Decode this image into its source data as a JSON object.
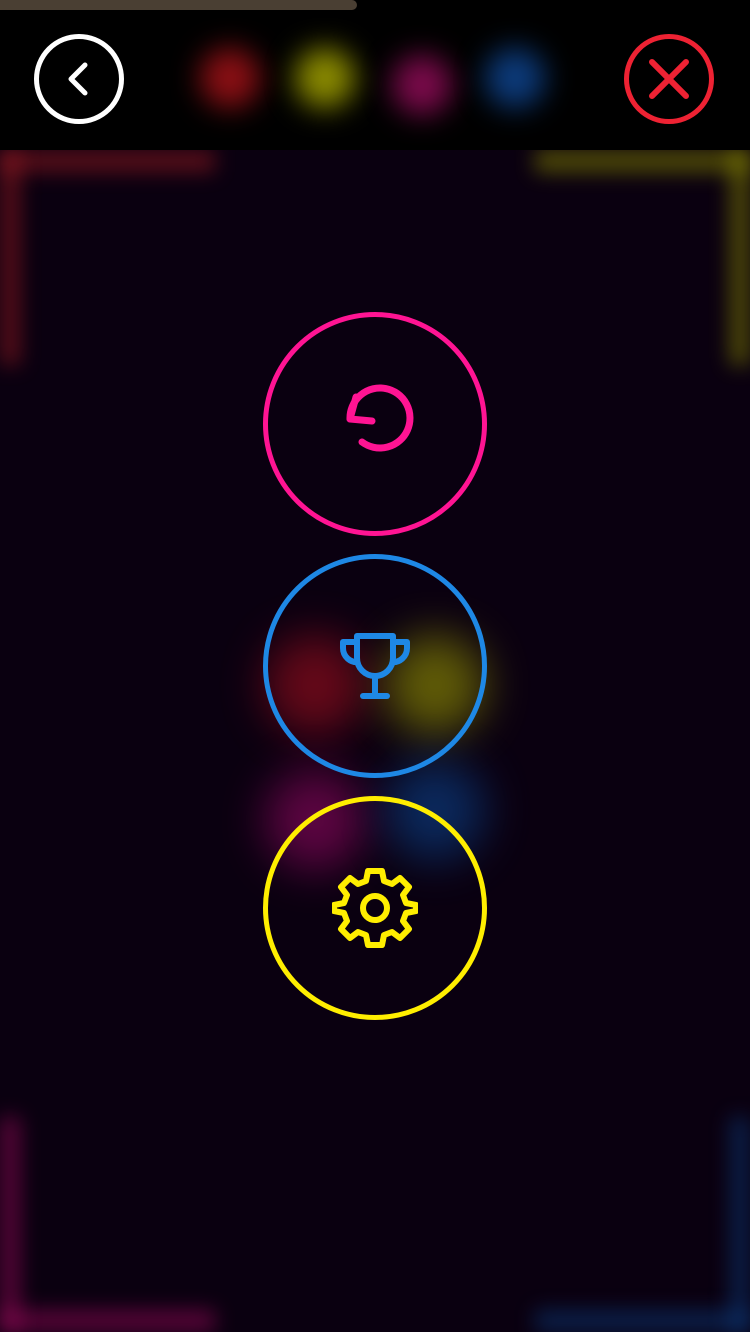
{
  "colors": {
    "background": "#0a0010",
    "topbar": "#000000",
    "back": "#ffffff",
    "close": "#ee2233",
    "restart": "#ff1493",
    "trophy": "#1e88e5",
    "settings": "#ffee00",
    "progress": "#4a3f33"
  },
  "progress": 0.476,
  "topbar": {
    "back_icon": "chevron-left-icon",
    "close_icon": "close-icon",
    "blurred_colors": [
      "#8a0f14",
      "#8a8a00",
      "#7a0a4a",
      "#0c3a7a"
    ]
  },
  "menu": {
    "buttons": [
      {
        "name": "restart-button",
        "icon": "restart-icon",
        "color": "#ff1493"
      },
      {
        "name": "leaderboard-button",
        "icon": "trophy-icon",
        "color": "#1e88e5"
      },
      {
        "name": "settings-button",
        "icon": "gear-icon",
        "color": "#ffee00"
      }
    ]
  }
}
